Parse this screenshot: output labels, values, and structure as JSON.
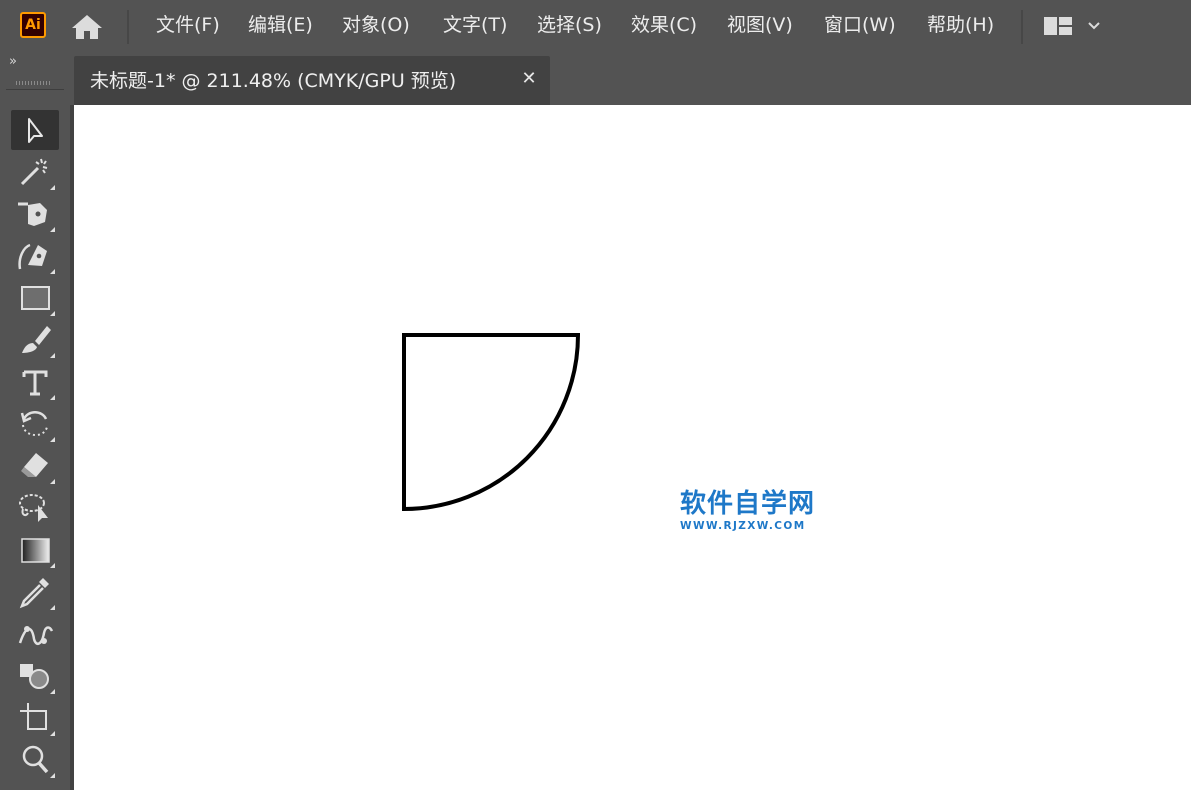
{
  "app": {
    "logo_text": "Ai",
    "brand_color": "#ff9a00"
  },
  "menubar": {
    "home_icon": "home-icon",
    "items": [
      "文件(F)",
      "编辑(E)",
      "对象(O)",
      "文字(T)",
      "选择(S)",
      "效果(C)",
      "视图(V)",
      "窗口(W)",
      "帮助(H)"
    ],
    "workspace_icon": "workspace-layout-icon"
  },
  "toolbar": {
    "collapse_label": "»",
    "tools": [
      {
        "name": "selection-tool",
        "icon": "arrow-icon",
        "active": true
      },
      {
        "name": "magic-wand-tool",
        "icon": "magic-wand-icon"
      },
      {
        "name": "pen-tool",
        "icon": "pen-icon"
      },
      {
        "name": "curvature-tool",
        "icon": "curvature-pen-icon"
      },
      {
        "name": "rectangle-tool",
        "icon": "rectangle-icon"
      },
      {
        "name": "paintbrush-tool",
        "icon": "brush-icon"
      },
      {
        "name": "type-tool",
        "icon": "type-icon"
      },
      {
        "name": "rotate-tool",
        "icon": "rotate-icon"
      },
      {
        "name": "eraser-tool",
        "icon": "eraser-icon"
      },
      {
        "name": "lasso-tool",
        "icon": "lasso-select-icon"
      },
      {
        "name": "gradient-tool",
        "icon": "gradient-icon"
      },
      {
        "name": "eyedropper-tool",
        "icon": "eyedropper-icon"
      },
      {
        "name": "blend-tool",
        "icon": "blend-icon"
      },
      {
        "name": "shape-builder-tool",
        "icon": "shape-builder-icon"
      },
      {
        "name": "artboard-tool",
        "icon": "artboard-icon"
      },
      {
        "name": "zoom-tool",
        "icon": "zoom-icon"
      }
    ]
  },
  "document": {
    "tab_title": "未标题-1*  @  211.48%  (CMYK/GPU 预览)",
    "close_label": "✕"
  },
  "watermark": {
    "title": "软件自学网",
    "url": "WWW.RJZXW.COM",
    "color": "#1e78c8"
  }
}
